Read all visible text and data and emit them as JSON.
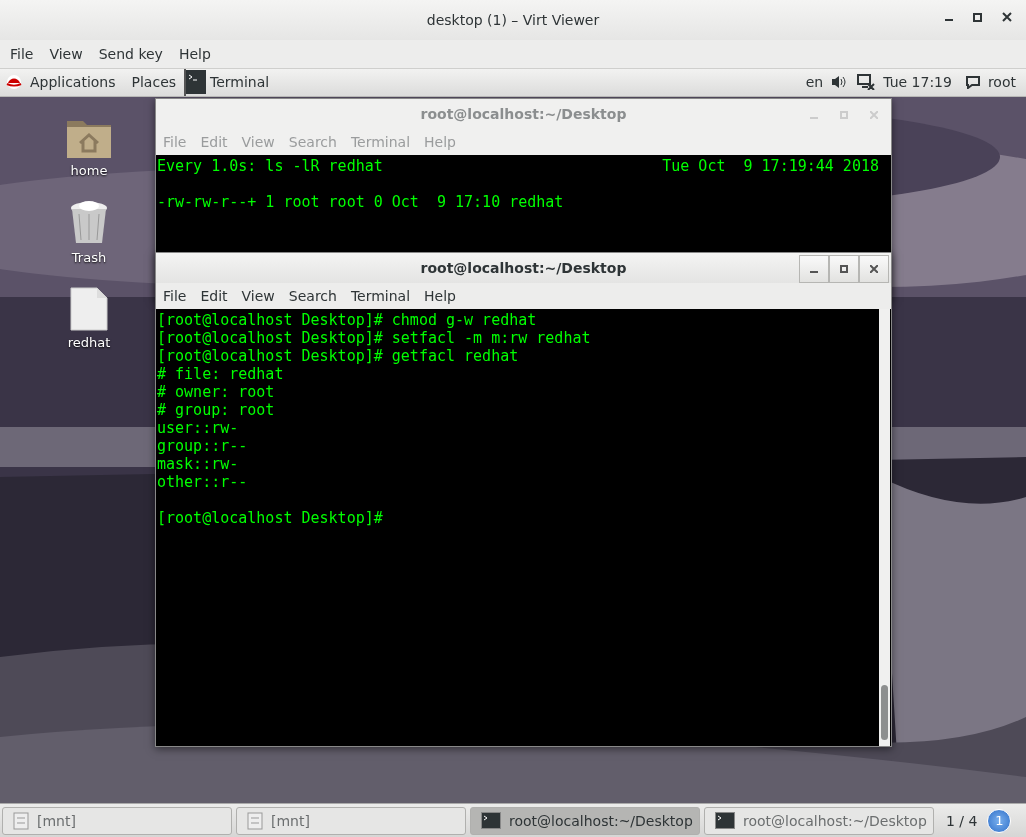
{
  "window": {
    "title": "desktop (1) – Virt Viewer",
    "menu": [
      "File",
      "View",
      "Send key",
      "Help"
    ]
  },
  "top_bar": {
    "applications": "Applications",
    "places": "Places",
    "active_app": "Terminal",
    "keyboard": "en",
    "clock": "Tue 17:19",
    "user": "root"
  },
  "desktop_icons": [
    {
      "kind": "home",
      "label": "home"
    },
    {
      "kind": "trash",
      "label": "Trash"
    },
    {
      "kind": "file",
      "label": "redhat"
    }
  ],
  "terminals": [
    {
      "title": "root@localhost:~/Desktop",
      "active": false,
      "menu": [
        "File",
        "Edit",
        "View",
        "Search",
        "Terminal",
        "Help"
      ],
      "header": {
        "left": "Every 1.0s: ls -lR redhat",
        "right": "Tue Oct  9 17:19:44 2018"
      },
      "blocks": [
        [
          "-rw-rw-r--+ 1 root root 0 Oct  9 17:10 redhat"
        ]
      ]
    },
    {
      "title": "root@localhost:~/Desktop",
      "active": true,
      "menu": [
        "File",
        "Edit",
        "View",
        "Search",
        "Terminal",
        "Help"
      ],
      "blocks": [
        [
          "[root@localhost Desktop]# chmod g-w redhat",
          "[root@localhost Desktop]# setfacl -m m:rw redhat",
          "[root@localhost Desktop]# getfacl redhat",
          "# file: redhat",
          "# owner: root",
          "# group: root",
          "user::rw-",
          "group::r--",
          "mask::rw-",
          "other::r--"
        ],
        [
          "[root@localhost Desktop]#"
        ]
      ]
    }
  ],
  "taskbar": {
    "items": [
      {
        "kind": "folder",
        "label": "[mnt]",
        "selected": false
      },
      {
        "kind": "folder",
        "label": "[mnt]",
        "selected": false
      },
      {
        "kind": "terminal",
        "label": "root@localhost:~/Desktop",
        "selected": true
      },
      {
        "kind": "terminal",
        "label": "root@localhost:~/Desktop",
        "selected": false
      }
    ],
    "pager": "1 / 4",
    "notifications": "1"
  }
}
